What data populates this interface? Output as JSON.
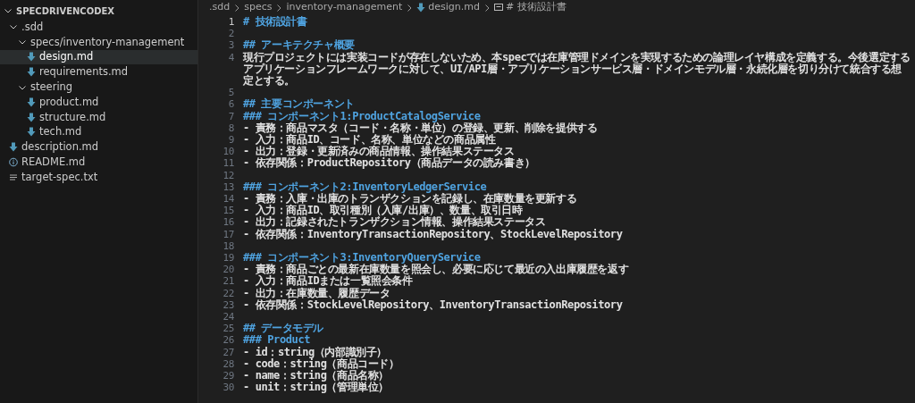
{
  "explorer": {
    "title": "SPECDRIVENCODEX",
    "expanded": true,
    "items": [
      {
        "label": ".sdd",
        "kind": "folder",
        "expanded": true,
        "selected": false,
        "children": [
          {
            "label": "specs/inventory-management",
            "kind": "folder",
            "expanded": true,
            "selected": false,
            "children": [
              {
                "label": "design.md",
                "kind": "md",
                "selected": true
              },
              {
                "label": "requirements.md",
                "kind": "md",
                "selected": false
              }
            ]
          },
          {
            "label": "steering",
            "kind": "folder",
            "expanded": true,
            "selected": false,
            "children": [
              {
                "label": "product.md",
                "kind": "md",
                "selected": false
              },
              {
                "label": "structure.md",
                "kind": "md",
                "selected": false
              },
              {
                "label": "tech.md",
                "kind": "md",
                "selected": false
              }
            ]
          }
        ]
      },
      {
        "label": "description.md",
        "kind": "md",
        "selected": false
      },
      {
        "label": "README.md",
        "kind": "info",
        "selected": false
      },
      {
        "label": "target-spec.txt",
        "kind": "txt",
        "selected": false
      }
    ]
  },
  "breadcrumb": [
    {
      "label": ".sdd",
      "kind": "folder"
    },
    {
      "label": "specs",
      "kind": "folder"
    },
    {
      "label": "inventory-management",
      "kind": "folder"
    },
    {
      "label": "design.md",
      "kind": "md"
    },
    {
      "label": "# 技術設計書",
      "kind": "symbol"
    }
  ],
  "lines": [
    {
      "number": "1",
      "kind": "h1",
      "text": "# 技術設計書",
      "current": true
    },
    {
      "number": "2",
      "kind": "blank",
      "current": false
    },
    {
      "number": "3",
      "kind": "h2",
      "text": "## アーキテクチャ概要",
      "current": false
    },
    {
      "number": "4",
      "kind": "text",
      "text": "現行プロジェクトには実装コードが存在しないため、本specでは在庫管理ドメインを実現するための論理レイヤ構成を定義する。今後選定するアプリケーションフレームワークに対して、UI/API層・アプリケーションサービス層・ドメインモデル層・永続化層を切り分けて統合する想定とする。",
      "current": false
    },
    {
      "number": "5",
      "kind": "blank",
      "current": false
    },
    {
      "number": "6",
      "kind": "h2",
      "text": "## 主要コンポーネント",
      "current": false
    },
    {
      "number": "7",
      "kind": "h3",
      "text": "### コンポーネント1:ProductCatalogService",
      "current": false
    },
    {
      "number": "8",
      "kind": "text",
      "text": "- 責務：商品マスタ（コード・名称・単位）の登録、更新、削除を提供する",
      "current": false
    },
    {
      "number": "9",
      "kind": "text",
      "text": "- 入力：商品ID、コード、名称、単位などの商品属性",
      "current": false
    },
    {
      "number": "10",
      "kind": "text",
      "text": "- 出力：登録・更新済みの商品情報、操作結果ステータス",
      "current": false
    },
    {
      "number": "11",
      "kind": "text",
      "text": "- 依存関係：ProductRepository（商品データの読み書き）",
      "current": false
    },
    {
      "number": "12",
      "kind": "blank",
      "current": false
    },
    {
      "number": "13",
      "kind": "h3",
      "text": "### コンポーネント2:InventoryLedgerService",
      "current": false
    },
    {
      "number": "14",
      "kind": "text",
      "text": "- 責務：入庫・出庫のトランザクションを記録し、在庫数量を更新する",
      "current": false
    },
    {
      "number": "15",
      "kind": "text",
      "text": "- 入力：商品ID、取引種別（入庫/出庫）、数量、取引日時",
      "current": false
    },
    {
      "number": "16",
      "kind": "text",
      "text": "- 出力：記録されたトランザクション情報、操作結果ステータス",
      "current": false
    },
    {
      "number": "17",
      "kind": "text",
      "text": "- 依存関係：InventoryTransactionRepository、StockLevelRepository",
      "current": false
    },
    {
      "number": "18",
      "kind": "blank",
      "current": false
    },
    {
      "number": "19",
      "kind": "h3",
      "text": "### コンポーネント3:InventoryQueryService",
      "current": false
    },
    {
      "number": "20",
      "kind": "text",
      "text": "- 責務：商品ごとの最新在庫数量を照会し、必要に応じて最近の入出庫履歴を返す",
      "current": false
    },
    {
      "number": "21",
      "kind": "text",
      "text": "- 入力：商品IDまたは一覧照会条件",
      "current": false
    },
    {
      "number": "22",
      "kind": "text",
      "text": "- 出力：在庫数量、履歴データ",
      "current": false
    },
    {
      "number": "23",
      "kind": "text",
      "text": "- 依存関係：StockLevelRepository、InventoryTransactionRepository",
      "current": false
    },
    {
      "number": "24",
      "kind": "blank",
      "current": false
    },
    {
      "number": "25",
      "kind": "h2",
      "text": "## データモデル",
      "current": false
    },
    {
      "number": "26",
      "kind": "h3",
      "text": "### Product",
      "current": false
    },
    {
      "number": "27",
      "kind": "text",
      "text": "- id：string（内部識別子）",
      "current": false
    },
    {
      "number": "28",
      "kind": "text",
      "text": "- code：string（商品コード）",
      "current": false
    },
    {
      "number": "29",
      "kind": "text",
      "text": "- name：string（商品名称）",
      "current": false
    },
    {
      "number": "30",
      "kind": "text",
      "text": "- unit：string（管理単位）",
      "current": false
    }
  ]
}
